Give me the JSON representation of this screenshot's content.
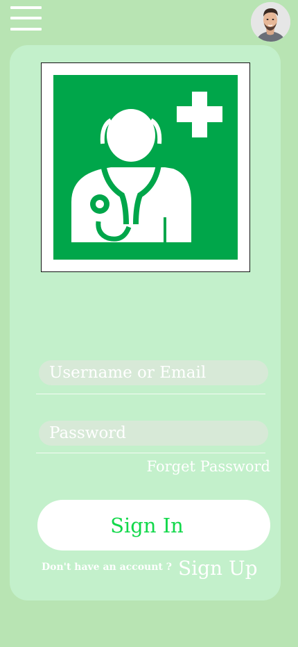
{
  "header": {
    "menu_icon": "hamburger-menu-icon",
    "avatar_icon": "user-avatar"
  },
  "logo": {
    "icon": "doctor-stethoscope-plus-icon",
    "colors": {
      "background": "#00a64a",
      "figure": "#ffffff",
      "frame": "#ffffff"
    }
  },
  "form": {
    "username_placeholder": "Username or Email",
    "password_placeholder": "Password",
    "forget_password": "Forget Password",
    "sign_in": "Sign In",
    "no_account": "Don't have an account ?",
    "sign_up": "Sign Up"
  },
  "colors": {
    "page_bg": "#b8e4b3",
    "card_bg": "#c3f0cb",
    "input_bg": "#d7e9d7",
    "accent": "#12d84a"
  }
}
